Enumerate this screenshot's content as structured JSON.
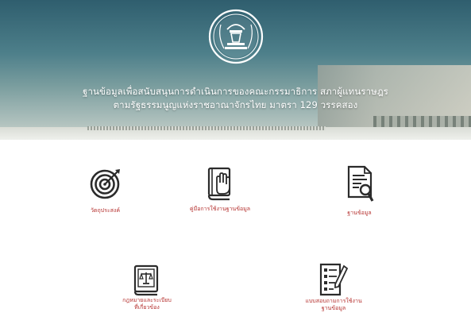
{
  "header": {
    "title_line1": "ฐานข้อมูลเพื่อสนับสนุนการดำเนินการของคณะกรรมาธิการ สภาผู้แทนราษฎร",
    "title_line2": "ตามรัฐธรรมนูญแห่งราชอาณาจักรไทย มาตรา 129 วรรคสอง",
    "logo_icon": "parliament-seal-icon"
  },
  "menu": {
    "items": [
      {
        "label": "วัตถุประสงค์",
        "icon": "target-icon"
      },
      {
        "label": "คู่มือการใช้งานฐานข้อมูล",
        "icon": "manual-book-icon"
      },
      {
        "label": "ฐานข้อมูล",
        "icon": "document-search-icon"
      },
      {
        "label_line1": "กฎหมายและระเบียบ",
        "label_line2": "ที่เกี่ยวข้อง",
        "icon": "law-book-icon"
      },
      {
        "label_line1": "แบบสอบถามการใช้งาน",
        "label_line2": "ฐานข้อมูล",
        "icon": "survey-form-icon"
      }
    ]
  },
  "colors": {
    "label": "#b5312f",
    "icon": "#2b2b2b",
    "hero_top": "#2f5e6e"
  }
}
